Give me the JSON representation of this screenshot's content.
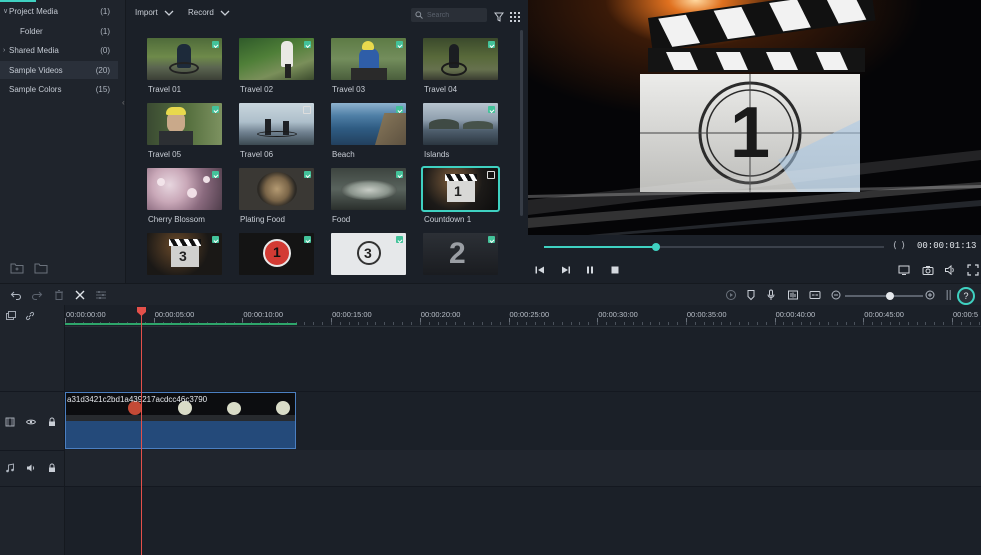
{
  "sidebar": {
    "items": [
      {
        "label": "Project Media",
        "count": "(1)",
        "expanded": true
      },
      {
        "label": "Folder",
        "count": "(1)"
      },
      {
        "label": "Shared Media",
        "count": "(0)",
        "expanded": false
      },
      {
        "label": "Sample Videos",
        "count": "(20)",
        "selected": true
      },
      {
        "label": "Sample Colors",
        "count": "(15)"
      }
    ]
  },
  "media": {
    "import_label": "Import",
    "record_label": "Record",
    "search_placeholder": "Search",
    "tiles": [
      {
        "name": "Travel 01"
      },
      {
        "name": "Travel 02"
      },
      {
        "name": "Travel 03"
      },
      {
        "name": "Travel 04"
      },
      {
        "name": "Travel 05"
      },
      {
        "name": "Travel 06"
      },
      {
        "name": "Beach"
      },
      {
        "name": "Islands"
      },
      {
        "name": "Cherry Blossom"
      },
      {
        "name": "Plating Food"
      },
      {
        "name": "Food"
      },
      {
        "name": "Countdown 1"
      },
      {
        "name": ""
      },
      {
        "name": ""
      },
      {
        "name": ""
      },
      {
        "name": ""
      }
    ],
    "selected_tile": "Countdown 1"
  },
  "preview": {
    "timecode": "00:00:01:13",
    "scrub_progress": 0.33,
    "countdown_digit": "1"
  },
  "timeline": {
    "ruler_labels": [
      "00:00:00:00",
      "00:00:05:00",
      "00:00:10:00",
      "00:00:15:00",
      "00:00:20:00",
      "00:00:25:00",
      "00:00:30:00",
      "00:00:35:00",
      "00:00:40:00",
      "00:00:45:00",
      "00:00:5"
    ],
    "zoom_level": 0.58,
    "clip_name": "a31d3421c2bd1a439217acdcc46c3790"
  },
  "colors": {
    "accent": "#3fd1c1",
    "playhead": "#e4504a",
    "clip": "#244a7a",
    "download_badge": "#43c29a"
  }
}
